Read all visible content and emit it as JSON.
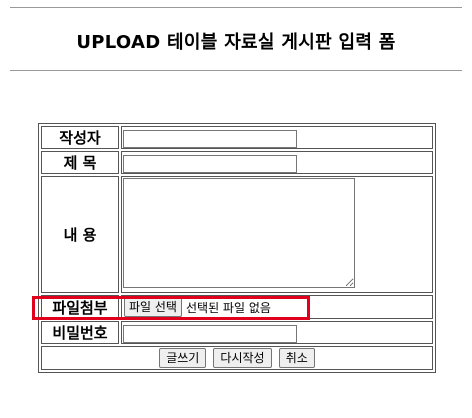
{
  "page": {
    "title": "UPLOAD 테이블 자료실 게시판 입력 폼"
  },
  "form": {
    "writer_label": "작성자",
    "writer_value": "",
    "subject_label": "제 목",
    "subject_value": "",
    "content_label": "내 용",
    "content_value": "",
    "file_label": "파일첨부",
    "file_button": "파일 선택",
    "file_status": "선택된 파일 없음",
    "password_label": "비밀번호",
    "password_value": "",
    "write_button": "글쓰기",
    "rewrite_button": "다시작성",
    "cancel_button": "취소"
  },
  "colors": {
    "highlight": "#e0001b"
  }
}
